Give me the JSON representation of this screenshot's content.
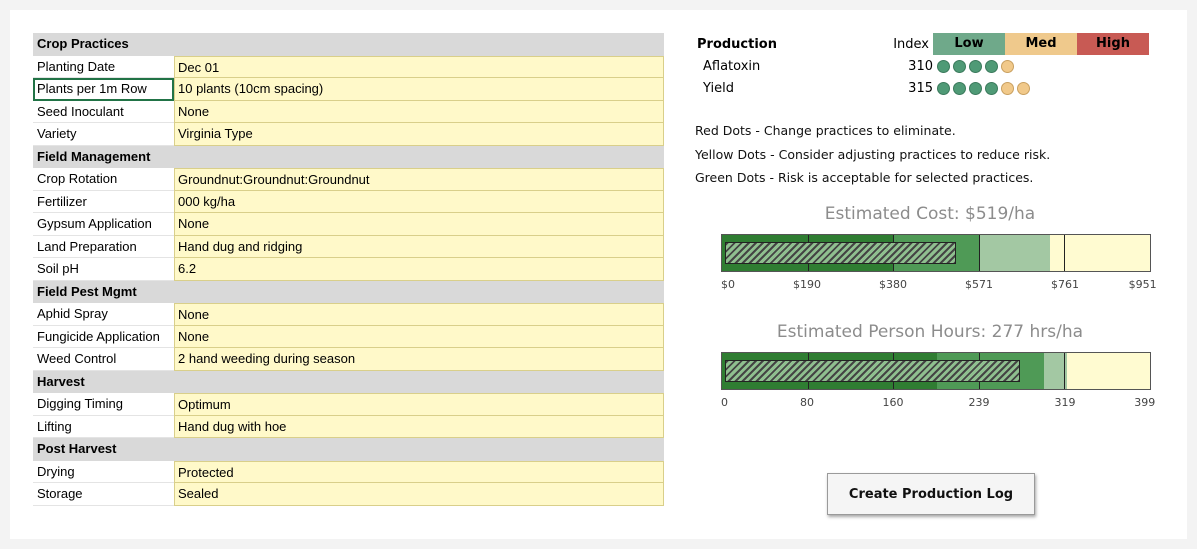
{
  "left": {
    "sections": [
      {
        "title": "Crop Practices",
        "rows": [
          {
            "label": "Planting Date",
            "value": "Dec 01"
          },
          {
            "label": "Plants per 1m Row",
            "value": "10 plants (10cm spacing)"
          },
          {
            "label": "Seed Inoculant",
            "value": "None"
          },
          {
            "label": "Variety",
            "value": "Virginia Type"
          }
        ]
      },
      {
        "title": "Field Management",
        "rows": [
          {
            "label": "Crop Rotation",
            "value": "Groundnut:Groundnut:Groundnut"
          },
          {
            "label": "Fertilizer",
            "value": "000 kg/ha"
          },
          {
            "label": "Gypsum Application",
            "value": "None"
          },
          {
            "label": "Land Preparation",
            "value": "Hand dug and ridging"
          },
          {
            "label": "Soil pH",
            "value": "6.2"
          }
        ]
      },
      {
        "title": "Field Pest Mgmt",
        "rows": [
          {
            "label": "Aphid Spray",
            "value": "None"
          },
          {
            "label": "Fungicide Application",
            "value": "None"
          },
          {
            "label": "Weed Control",
            "value": "2 hand weeding during season"
          }
        ]
      },
      {
        "title": "Harvest",
        "rows": [
          {
            "label": "Digging Timing",
            "value": "Optimum"
          },
          {
            "label": "Lifting",
            "value": "Hand dug with hoe"
          }
        ]
      },
      {
        "title": "Post Harvest",
        "rows": [
          {
            "label": "Drying",
            "value": "Protected"
          },
          {
            "label": "Storage",
            "value": "Sealed"
          }
        ]
      }
    ]
  },
  "production": {
    "title": "Production",
    "index_label": "Index",
    "levels": [
      {
        "label": "Low",
        "color": "#6fa98a"
      },
      {
        "label": "Med",
        "color": "#efc98c"
      },
      {
        "label": "High",
        "color": "#c85a54"
      }
    ],
    "rows": [
      {
        "name": "Aflatoxin",
        "index": "310",
        "dots": [
          "g",
          "g",
          "g",
          "g",
          "y"
        ]
      },
      {
        "name": "Yield",
        "index": "315",
        "dots": [
          "g",
          "g",
          "g",
          "g",
          "y",
          "y"
        ]
      }
    ]
  },
  "legend": {
    "red": "Red Dots - Change practices to eliminate.",
    "yellow": "Yellow Dots - Consider adjusting practices to reduce risk.",
    "green": "Green Dots - Risk is acceptable for selected practices."
  },
  "cost": {
    "title": "Estimated Cost: $519/ha",
    "value": 519,
    "max": 951,
    "zones": [
      {
        "to": 571,
        "color": "#3f8a3f"
      },
      {
        "to": 728,
        "color": "#a3c8a3"
      },
      {
        "to": 951,
        "color": "#fffbd1"
      }
    ],
    "dark_to": 380,
    "ticks": [
      "$0",
      "$190",
      "$380",
      "$571",
      "$761",
      "$951"
    ]
  },
  "hours": {
    "title": "Estimated Person Hours: 277 hrs/ha",
    "value": 277,
    "max": 399,
    "zones": [
      {
        "to": 300,
        "color": "#3f8a3f"
      },
      {
        "to": 322,
        "color": "#a3c8a3"
      },
      {
        "to": 399,
        "color": "#fffbd1"
      }
    ],
    "dark_to": 200,
    "ticks": [
      "0",
      "80",
      "160",
      "239",
      "319",
      "399"
    ]
  },
  "button_label": "Create Production Log"
}
